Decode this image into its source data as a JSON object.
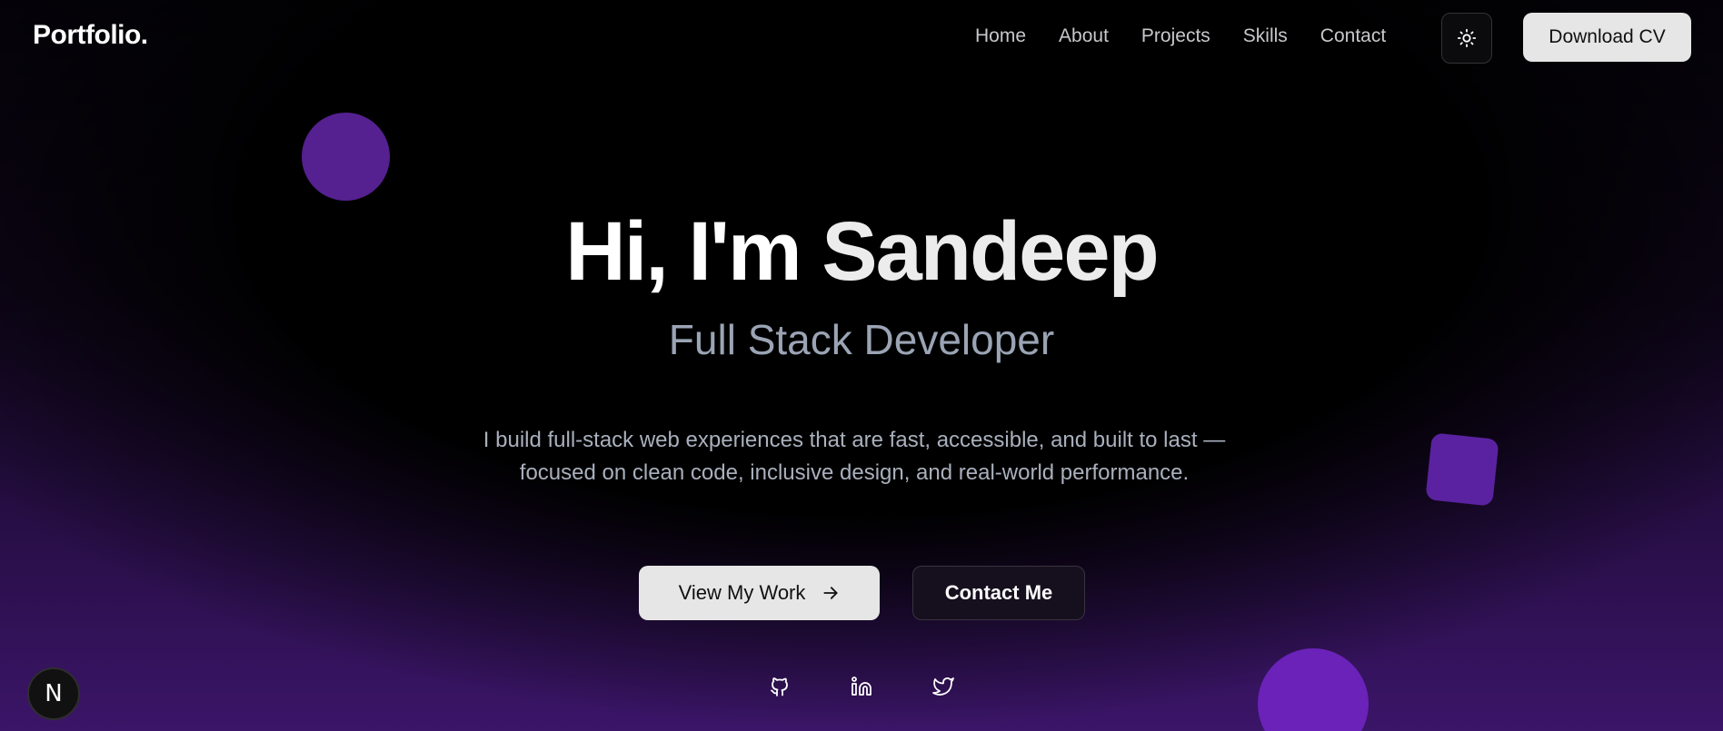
{
  "nav": {
    "brand": "Portfolio.",
    "links": [
      "Home",
      "About",
      "Projects",
      "Skills",
      "Contact"
    ],
    "theme_toggle_icon": "sun-icon",
    "download_cv_label": "Download CV"
  },
  "hero": {
    "greeting": "Hi, I'm",
    "name": "Sandeep",
    "role": "Full Stack Developer",
    "description": "I build full-stack web experiences that are fast, accessible, and built to last — focused on clean code, inclusive design, and real-world performance.",
    "primary_cta": "View My Work",
    "primary_cta_icon": "arrow-right-icon",
    "secondary_cta": "Contact Me"
  },
  "socials": [
    {
      "icon": "github-icon"
    },
    {
      "icon": "linkedin-icon"
    },
    {
      "icon": "twitter-icon"
    }
  ],
  "badge": {
    "label": "N",
    "icon": "nextjs-icon"
  },
  "colors": {
    "background": "#000000",
    "accent_purple": "#5a22a0",
    "button_light": "#e6e6e6"
  }
}
